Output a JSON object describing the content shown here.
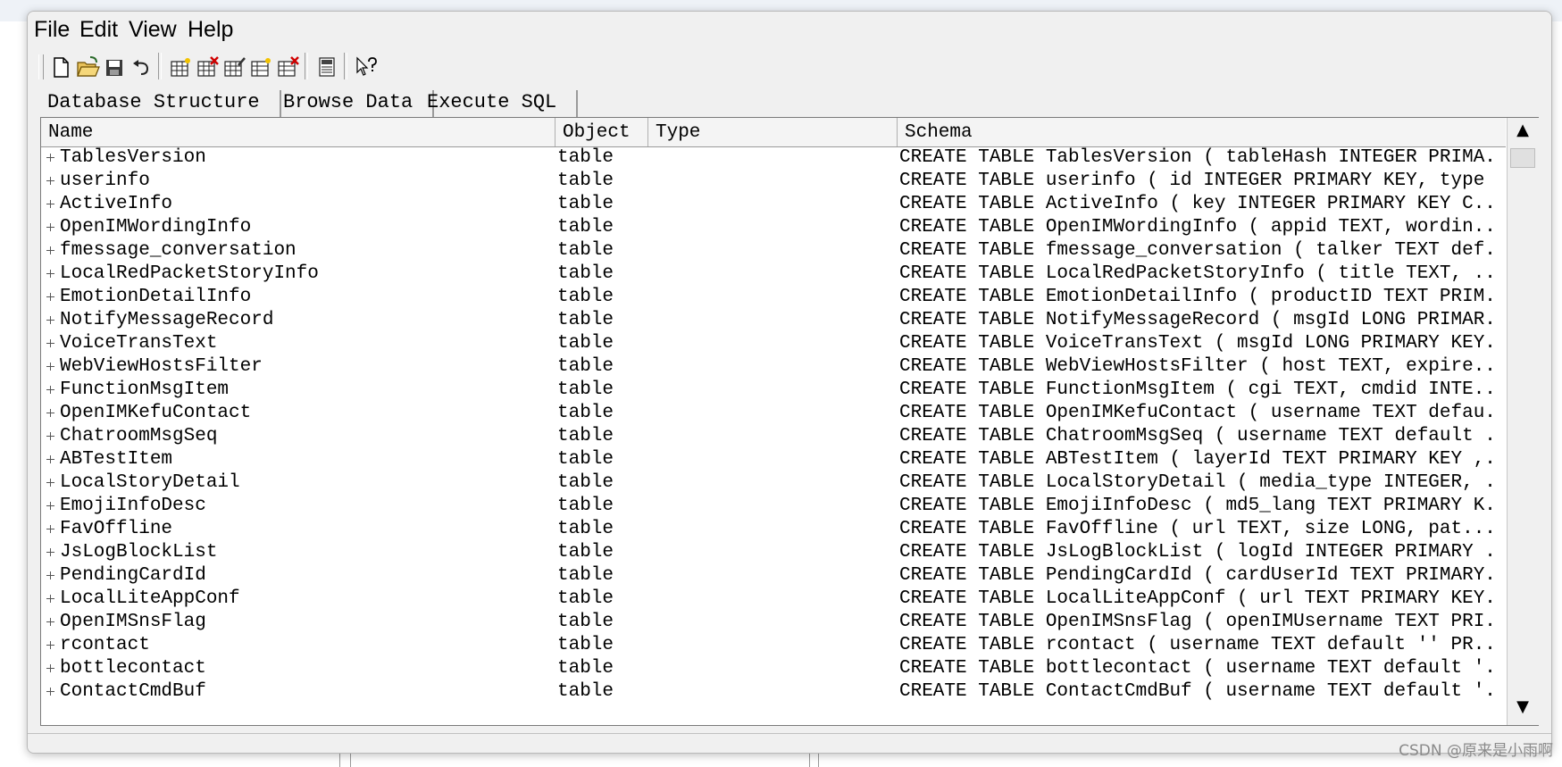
{
  "menu": {
    "items": [
      "File",
      "Edit",
      "View",
      "Help"
    ]
  },
  "tabs": [
    {
      "label": "Database Structure"
    },
    {
      "label": "Browse Data"
    },
    {
      "label": "Execute SQL"
    }
  ],
  "table": {
    "columns": {
      "name": "Name",
      "object": "Object",
      "type": "Type",
      "schema": "Schema"
    },
    "rows": [
      {
        "name": "TablesVersion",
        "object": "table",
        "type": "",
        "schema": "CREATE TABLE TablesVersion (  tableHash INTEGER PRIMA..."
      },
      {
        "name": "userinfo",
        "object": "table",
        "type": "",
        "schema": "CREATE TABLE userinfo ( id INTEGER PRIMARY KEY, type ..."
      },
      {
        "name": "ActiveInfo",
        "object": "table",
        "type": "",
        "schema": "CREATE TABLE ActiveInfo (  key INTEGER PRIMARY KEY  C..."
      },
      {
        "name": "OpenIMWordingInfo",
        "object": "table",
        "type": "",
        "schema": "CREATE TABLE OpenIMWordingInfo (  appid TEXT,  wordin..."
      },
      {
        "name": "fmessage_conversation",
        "object": "table",
        "type": "",
        "schema": "CREATE TABLE fmessage_conversation (  talker TEXT def..."
      },
      {
        "name": "LocalRedPacketStoryInfo",
        "object": "table",
        "type": "",
        "schema": "CREATE TABLE LocalRedPacketStoryInfo (  title TEXT,  ..."
      },
      {
        "name": "EmotionDetailInfo",
        "object": "table",
        "type": "",
        "schema": "CREATE TABLE EmotionDetailInfo (  productID TEXT PRIM..."
      },
      {
        "name": "NotifyMessageRecord",
        "object": "table",
        "type": "",
        "schema": "CREATE TABLE NotifyMessageRecord (  msgId LONG PRIMAR..."
      },
      {
        "name": "VoiceTransText",
        "object": "table",
        "type": "",
        "schema": "CREATE TABLE VoiceTransText (  msgId LONG PRIMARY KEY..."
      },
      {
        "name": "WebViewHostsFilter",
        "object": "table",
        "type": "",
        "schema": "CREATE TABLE WebViewHostsFilter (  host TEXT,  expire..."
      },
      {
        "name": "FunctionMsgItem",
        "object": "table",
        "type": "",
        "schema": "CREATE TABLE FunctionMsgItem (  cgi TEXT,  cmdid INTE..."
      },
      {
        "name": "OpenIMKefuContact",
        "object": "table",
        "type": "",
        "schema": "CREATE TABLE OpenIMKefuContact (  username TEXT defau..."
      },
      {
        "name": "ChatroomMsgSeq",
        "object": "table",
        "type": "",
        "schema": "CREATE TABLE ChatroomMsgSeq (  username TEXT default ..."
      },
      {
        "name": "ABTestItem",
        "object": "table",
        "type": "",
        "schema": "CREATE TABLE ABTestItem (  layerId TEXT PRIMARY KEY ,..."
      },
      {
        "name": "LocalStoryDetail",
        "object": "table",
        "type": "",
        "schema": "CREATE TABLE LocalStoryDetail (  media_type INTEGER, ..."
      },
      {
        "name": "EmojiInfoDesc",
        "object": "table",
        "type": "",
        "schema": "CREATE TABLE EmojiInfoDesc (  md5_lang TEXT PRIMARY K..."
      },
      {
        "name": "FavOffline",
        "object": "table",
        "type": "",
        "schema": "CREATE TABLE FavOffline (  url TEXT,  size LONG,  pat..."
      },
      {
        "name": "JsLogBlockList",
        "object": "table",
        "type": "",
        "schema": "CREATE TABLE JsLogBlockList (  logId INTEGER PRIMARY ..."
      },
      {
        "name": "PendingCardId",
        "object": "table",
        "type": "",
        "schema": "CREATE TABLE PendingCardId (  cardUserId TEXT PRIMARY..."
      },
      {
        "name": "LocalLiteAppConf",
        "object": "table",
        "type": "",
        "schema": "CREATE TABLE LocalLiteAppConf (  url TEXT PRIMARY KEY..."
      },
      {
        "name": "OpenIMSnsFlag",
        "object": "table",
        "type": "",
        "schema": "CREATE TABLE OpenIMSnsFlag (  openIMUsername TEXT PRI..."
      },
      {
        "name": "rcontact",
        "object": "table",
        "type": "",
        "schema": "CREATE TABLE rcontact (  username TEXT default ''  PR..."
      },
      {
        "name": "bottlecontact",
        "object": "table",
        "type": "",
        "schema": "CREATE TABLE bottlecontact (  username TEXT default '..."
      },
      {
        "name": "ContactCmdBuf",
        "object": "table",
        "type": "",
        "schema": "CREATE TABLE ContactCmdBuf (  username TEXT default '..."
      }
    ]
  },
  "watermark": "CSDN @原来是小雨啊",
  "toolbar": {
    "icons": [
      "new-database-icon",
      "open-database-icon",
      "save-icon",
      "undo-icon",
      "create-table-icon",
      "delete-table-icon",
      "modify-table-icon",
      "create-index-icon",
      "delete-index-icon",
      "log-window-icon",
      "whats-this-icon"
    ]
  }
}
